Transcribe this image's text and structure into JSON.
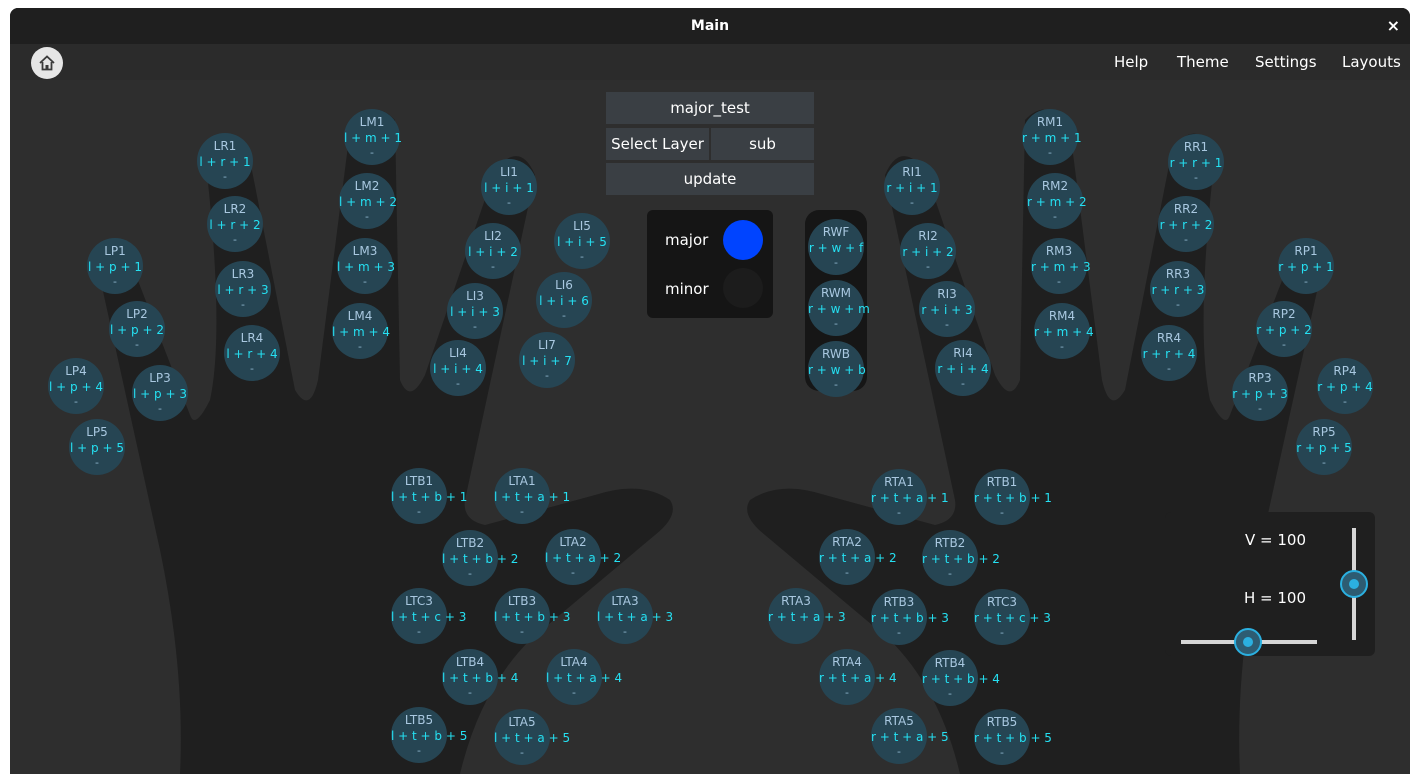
{
  "window": {
    "title": "Main",
    "close_symbol": "×"
  },
  "menu": {
    "help": "Help",
    "theme": "Theme",
    "settings": "Settings",
    "layouts": "Layouts",
    "home_icon": "home-icon"
  },
  "layer": {
    "name": "major_test",
    "select_label": "Select Layer",
    "sub_label": "sub",
    "update_label": "update"
  },
  "modes": [
    {
      "label": "major",
      "color": "#0044ff",
      "active": true
    },
    {
      "label": "minor",
      "color": "#1c1c1c",
      "active": false
    }
  ],
  "sliders": {
    "v_label": "V = 100",
    "h_label": "H = 100",
    "v_value": 100,
    "h_value": 100,
    "accent": "#2bb0e0"
  },
  "colors": {
    "key_bg": "#264553",
    "key_label": "#a9c8e0",
    "key_combo": "#25e0f2",
    "hand": "#1f1f1f"
  },
  "keys": [
    {
      "id": "LR1",
      "combo": "l + r + 1",
      "sub": "-"
    },
    {
      "id": "LR2",
      "combo": "l + r + 2",
      "sub": "-"
    },
    {
      "id": "LR3",
      "combo": "l + r + 3",
      "sub": "-"
    },
    {
      "id": "LR4",
      "combo": "l + r + 4",
      "sub": "-"
    },
    {
      "id": "LM1",
      "combo": "l + m + 1",
      "sub": "-"
    },
    {
      "id": "LM2",
      "combo": "l + m + 2",
      "sub": "-"
    },
    {
      "id": "LM3",
      "combo": "l + m + 3",
      "sub": "-"
    },
    {
      "id": "LM4",
      "combo": "l + m + 4",
      "sub": "-"
    },
    {
      "id": "LI1",
      "combo": "l + i + 1",
      "sub": "-"
    },
    {
      "id": "LI2",
      "combo": "l + i + 2",
      "sub": "-"
    },
    {
      "id": "LI3",
      "combo": "l + i + 3",
      "sub": "-"
    },
    {
      "id": "LI4",
      "combo": "l + i + 4",
      "sub": "-"
    },
    {
      "id": "LI5",
      "combo": "l + i + 5",
      "sub": "-"
    },
    {
      "id": "LI6",
      "combo": "l + i + 6",
      "sub": "-"
    },
    {
      "id": "LI7",
      "combo": "l + i + 7",
      "sub": "-"
    },
    {
      "id": "LP1",
      "combo": "l + p + 1",
      "sub": "-"
    },
    {
      "id": "LP2",
      "combo": "l + p + 2",
      "sub": "-"
    },
    {
      "id": "LP3",
      "combo": "l + p + 3",
      "sub": "-"
    },
    {
      "id": "LP4",
      "combo": "l + p + 4",
      "sub": "-"
    },
    {
      "id": "LP5",
      "combo": "l + p + 5",
      "sub": "-"
    },
    {
      "id": "LTB1",
      "combo": "l + t + b + 1",
      "sub": "-"
    },
    {
      "id": "LTA1",
      "combo": "l + t + a + 1",
      "sub": "-"
    },
    {
      "id": "LTB2",
      "combo": "l + t + b + 2",
      "sub": "-"
    },
    {
      "id": "LTA2",
      "combo": "l + t + a + 2",
      "sub": "-"
    },
    {
      "id": "LTC3",
      "combo": "l + t + c + 3",
      "sub": "-"
    },
    {
      "id": "LTB3",
      "combo": "l + t + b + 3",
      "sub": "-"
    },
    {
      "id": "LTA3",
      "combo": "l + t + a + 3",
      "sub": "-"
    },
    {
      "id": "LTB4",
      "combo": "l + t + b + 4",
      "sub": "-"
    },
    {
      "id": "LTA4",
      "combo": "l + t + a + 4",
      "sub": "-"
    },
    {
      "id": "LTB5",
      "combo": "l + t + b + 5",
      "sub": "-"
    },
    {
      "id": "LTA5",
      "combo": "l + t + a + 5",
      "sub": "-"
    },
    {
      "id": "RWF",
      "combo": "r + w + f",
      "sub": "-"
    },
    {
      "id": "RWM",
      "combo": "r + w + m",
      "sub": "-"
    },
    {
      "id": "RWB",
      "combo": "r + w + b",
      "sub": "-"
    },
    {
      "id": "RI1",
      "combo": "r + i + 1",
      "sub": "-"
    },
    {
      "id": "RI2",
      "combo": "r + i + 2",
      "sub": "-"
    },
    {
      "id": "RI3",
      "combo": "r + i + 3",
      "sub": "-"
    },
    {
      "id": "RI4",
      "combo": "r + i + 4",
      "sub": "-"
    },
    {
      "id": "RM1",
      "combo": "r + m + 1",
      "sub": "-"
    },
    {
      "id": "RM2",
      "combo": "r + m + 2",
      "sub": "-"
    },
    {
      "id": "RM3",
      "combo": "r + m + 3",
      "sub": "-"
    },
    {
      "id": "RM4",
      "combo": "r + m + 4",
      "sub": "-"
    },
    {
      "id": "RR1",
      "combo": "r + r + 1",
      "sub": "-"
    },
    {
      "id": "RR2",
      "combo": "r + r + 2",
      "sub": "-"
    },
    {
      "id": "RR3",
      "combo": "r + r + 3",
      "sub": "-"
    },
    {
      "id": "RR4",
      "combo": "r + r + 4",
      "sub": "-"
    },
    {
      "id": "RP1",
      "combo": "r + p + 1",
      "sub": "-"
    },
    {
      "id": "RP2",
      "combo": "r + p + 2",
      "sub": "-"
    },
    {
      "id": "RP3",
      "combo": "r + p + 3",
      "sub": "-"
    },
    {
      "id": "RP4",
      "combo": "r + p + 4",
      "sub": "-"
    },
    {
      "id": "RP5",
      "combo": "r + p + 5",
      "sub": "-"
    },
    {
      "id": "RTA1",
      "combo": "r + t + a + 1",
      "sub": "-"
    },
    {
      "id": "RTB1",
      "combo": "r + t + b + 1",
      "sub": "-"
    },
    {
      "id": "RTA2",
      "combo": "r + t + a + 2",
      "sub": "-"
    },
    {
      "id": "RTB2",
      "combo": "r + t + b + 2",
      "sub": "-"
    },
    {
      "id": "RTA3",
      "combo": "r + t + a + 3",
      "sub": ""
    },
    {
      "id": "RTB3",
      "combo": "r + t + b + 3",
      "sub": "-"
    },
    {
      "id": "RTC3",
      "combo": "r + t + c + 3",
      "sub": "-"
    },
    {
      "id": "RTA4",
      "combo": "r + t + a + 4",
      "sub": "-"
    },
    {
      "id": "RTB4",
      "combo": "r + t + b + 4",
      "sub": "-"
    },
    {
      "id": "RTA5",
      "combo": "r + t + a + 5",
      "sub": "-"
    },
    {
      "id": "RTB5",
      "combo": "r + t + b + 5",
      "sub": "-"
    }
  ]
}
